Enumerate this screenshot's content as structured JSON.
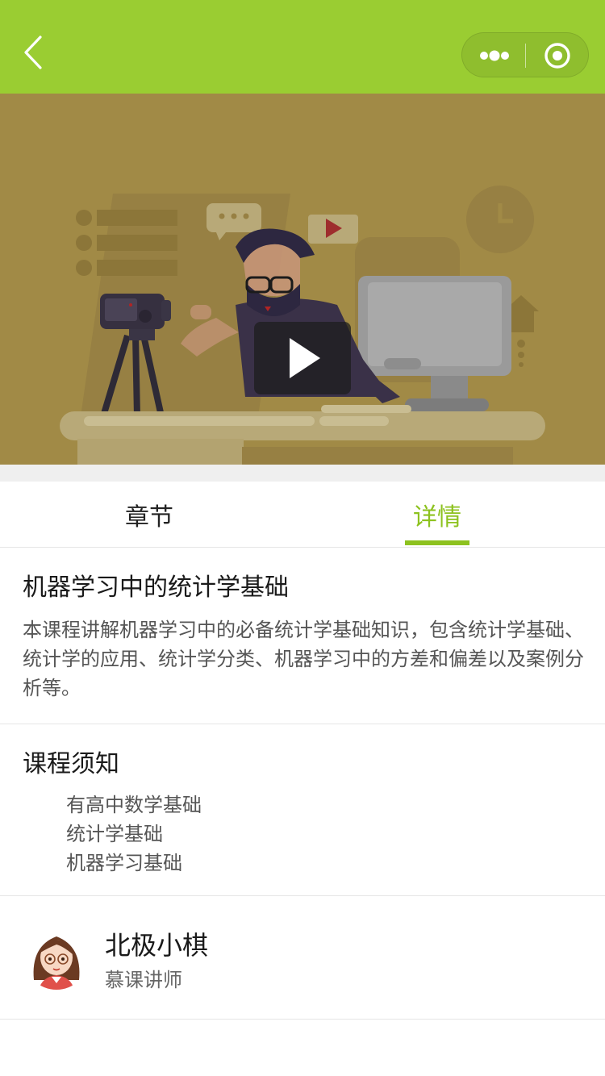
{
  "navbar": {
    "accent": "#9acd32",
    "back_icon": "chevron-left-icon",
    "more_icon": "more-dots-icon",
    "close_icon": "target-close-icon"
  },
  "video": {
    "play_icon": "play-icon"
  },
  "tabs": [
    {
      "label": "章节",
      "active": false
    },
    {
      "label": "详情",
      "active": true
    }
  ],
  "active_color": "#8dc21f",
  "course": {
    "title": "机器学习中的统计学基础",
    "description": "本课程讲解机器学习中的必备统计学基础知识，包含统计学基础、统计学的应用、统计学分类、机器学习中的方差和偏差以及案例分析等。"
  },
  "notice": {
    "title": "课程须知",
    "items": [
      "有高中数学基础",
      "统计学基础",
      "机器学习基础"
    ]
  },
  "teacher": {
    "name": "北极小棋",
    "role": "慕课讲师"
  }
}
